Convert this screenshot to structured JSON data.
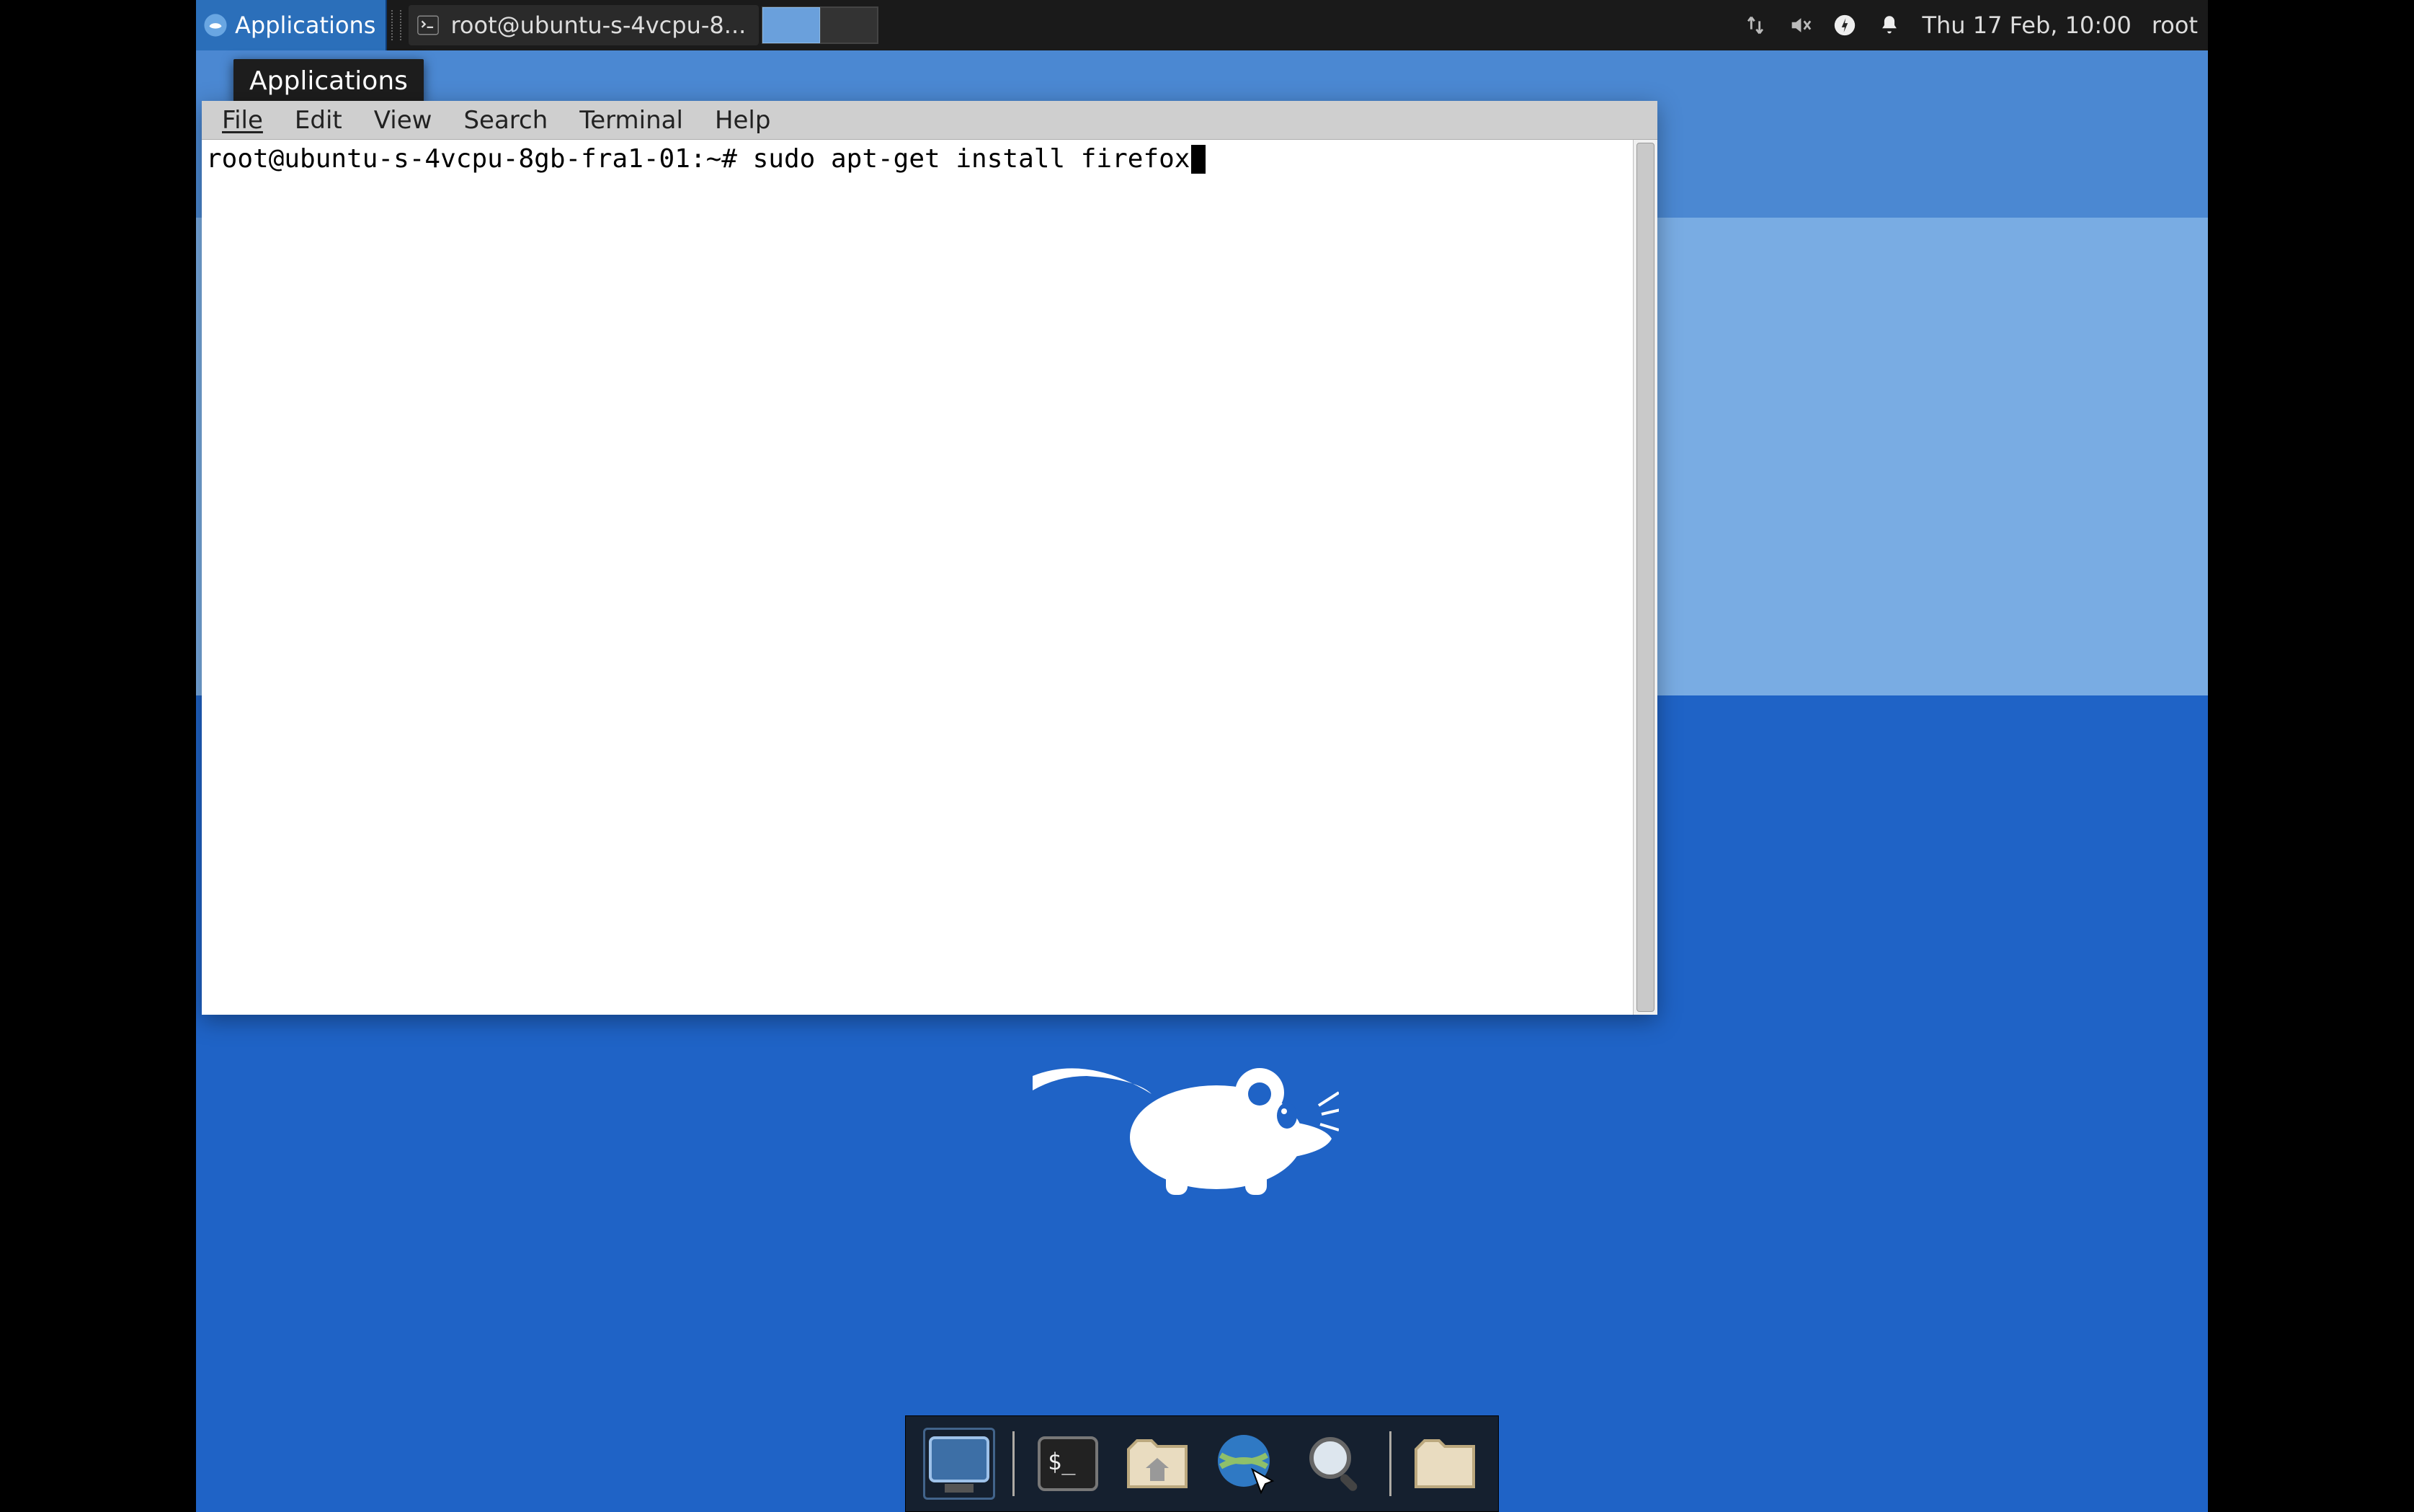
{
  "top_panel": {
    "applications_label": "Applications",
    "taskbar": {
      "window_title": "root@ubuntu-s-4vcpu-8..."
    },
    "clock": "Thu 17 Feb, 10:00",
    "user": "root",
    "icons": {
      "network": "network-updown-icon",
      "audio": "audio-muted-icon",
      "power": "power-icon",
      "notifications": "bell-icon"
    },
    "workspaces": {
      "count": 2,
      "active": 1
    }
  },
  "tooltip": {
    "applications": "Applications"
  },
  "terminal": {
    "menus": [
      "File",
      "Edit",
      "View",
      "Search",
      "Terminal",
      "Help"
    ],
    "prompt": "root@ubuntu-s-4vcpu-8gb-fra1-01:~#",
    "command": "sudo apt-get install firefox"
  },
  "dock": {
    "items": [
      {
        "name": "show-desktop",
        "active": true
      },
      {
        "name": "terminal"
      },
      {
        "name": "file-manager"
      },
      {
        "name": "web-browser"
      },
      {
        "name": "app-finder"
      },
      {
        "name": "user-home"
      }
    ]
  }
}
